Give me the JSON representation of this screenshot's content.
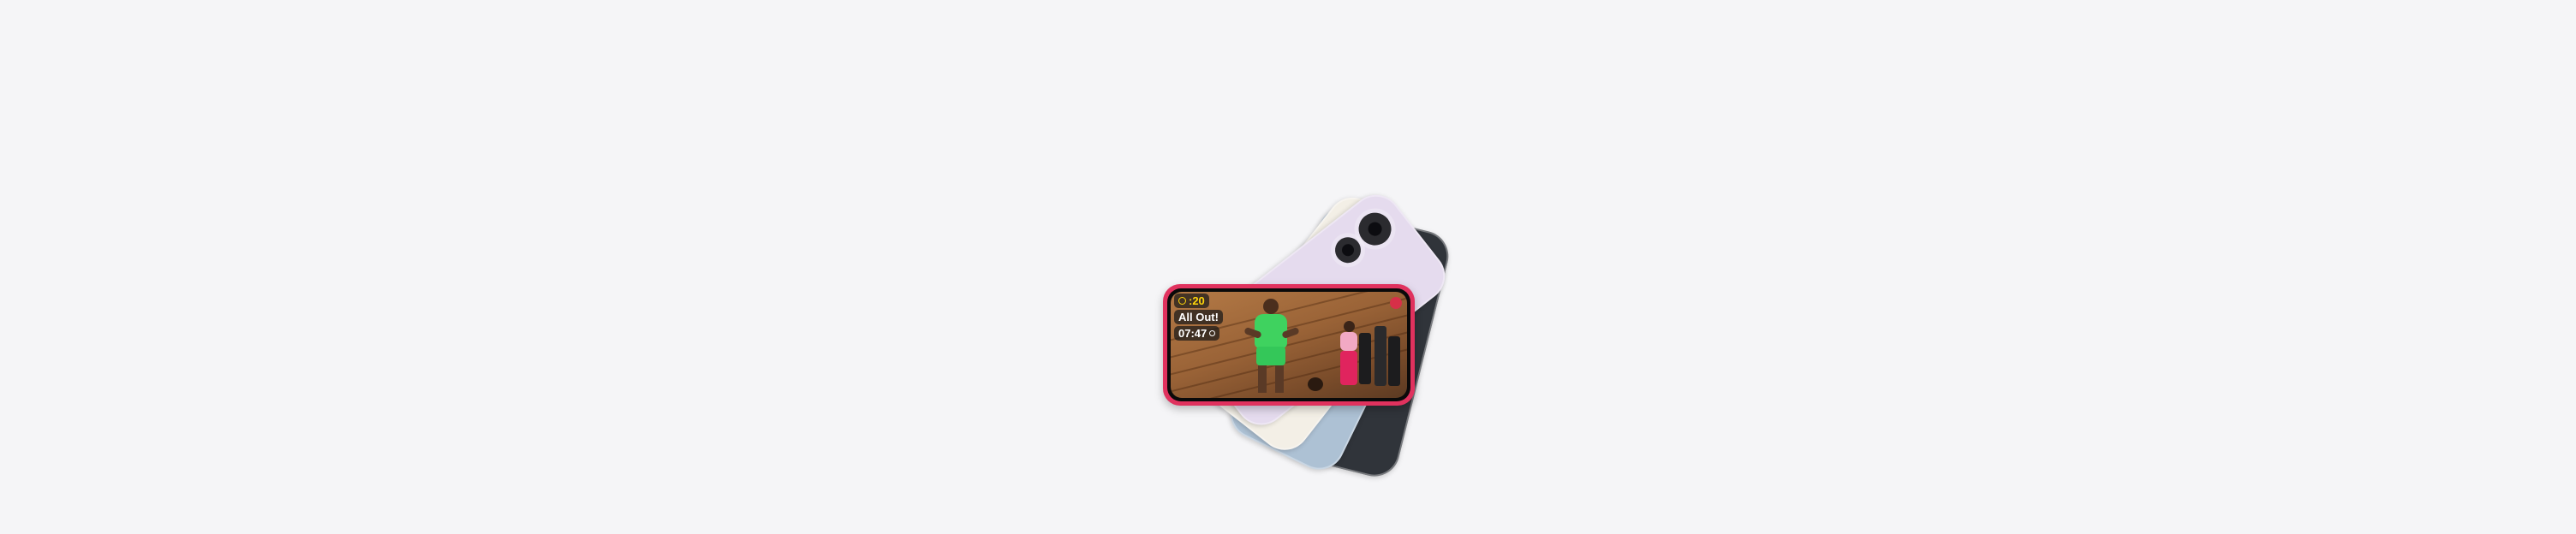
{
  "hero": {
    "product_image": "iPhone 15 in five colors fanned out",
    "colors": {
      "background": "#f5f5f7",
      "black": "#2f3338",
      "blue": "#a9bdd0",
      "yellow": "#f1eee6",
      "green": "#f2f3f1",
      "pink": "#e6dcee",
      "front_pink": "#e0325e"
    }
  },
  "workout": {
    "timer": ":20",
    "title": "All Out!",
    "elapsed": "07:47"
  }
}
